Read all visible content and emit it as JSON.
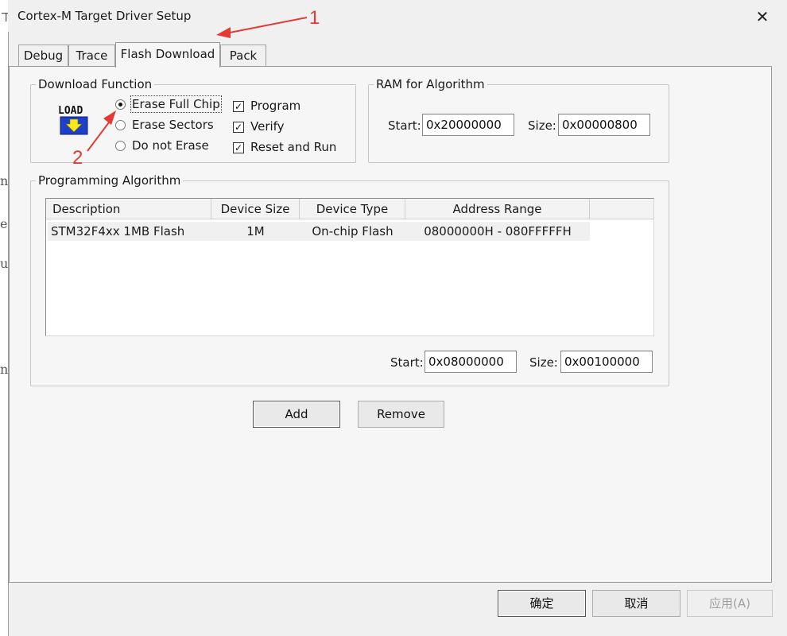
{
  "window": {
    "title": "Cortex-M Target Driver Setup",
    "close_glyph": "✕"
  },
  "tabs": [
    {
      "label": "Debug"
    },
    {
      "label": "Trace"
    },
    {
      "label": "Flash Download"
    },
    {
      "label": "Pack"
    }
  ],
  "download_function": {
    "legend": "Download Function",
    "radios": [
      {
        "label": "Erase Full Chip",
        "selected": true
      },
      {
        "label": "Erase Sectors",
        "selected": false
      },
      {
        "label": "Do not Erase",
        "selected": false
      }
    ],
    "checkboxes": [
      {
        "label": "Program",
        "checked": true
      },
      {
        "label": "Verify",
        "checked": true
      },
      {
        "label": "Reset and Run",
        "checked": true
      }
    ],
    "load_icon_text": "LOAD"
  },
  "ram_algorithm": {
    "legend": "RAM for Algorithm",
    "start_label": "Start:",
    "start_value": "0x20000000",
    "size_label": "Size:",
    "size_value": "0x00000800"
  },
  "programming_algorithm": {
    "legend": "Programming Algorithm",
    "columns": [
      "Description",
      "Device Size",
      "Device Type",
      "Address Range"
    ],
    "rows": [
      {
        "description": "STM32F4xx 1MB Flash",
        "size": "1M",
        "type": "On-chip Flash",
        "range": "08000000H - 080FFFFFH"
      }
    ],
    "start_label": "Start:",
    "start_value": "0x08000000",
    "size_label": "Size:",
    "size_value": "0x00100000"
  },
  "buttons": {
    "add": "Add",
    "remove": "Remove"
  },
  "footer": {
    "ok": "确定",
    "cancel": "取消",
    "apply": "应用(A)"
  },
  "annotations": {
    "one": "1",
    "two": "2",
    "color": "#e53935"
  }
}
